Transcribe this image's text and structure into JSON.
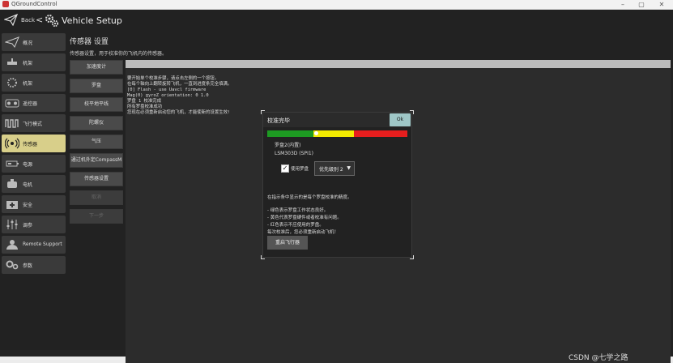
{
  "window": {
    "title": "QGroundControl"
  },
  "header": {
    "back_label": "Back",
    "back_arrow": "<",
    "title": "Vehicle Setup"
  },
  "sidebar": {
    "items": [
      {
        "label": "概况",
        "icon": "plane-outline-icon"
      },
      {
        "label": "机架",
        "icon": "frame-icon"
      },
      {
        "label": "机架",
        "icon": "dots-circle-icon"
      },
      {
        "label": "遥控器",
        "icon": "radio-icon"
      },
      {
        "label": "飞行模式",
        "icon": "wave-icon"
      },
      {
        "label": "传感器",
        "icon": "sensor-icon",
        "active": true
      },
      {
        "label": "电源",
        "icon": "battery-icon"
      },
      {
        "label": "电机",
        "icon": "motor-icon"
      },
      {
        "label": "安全",
        "icon": "safety-icon"
      },
      {
        "label": "调参",
        "icon": "sliders-icon"
      },
      {
        "label": "Remote Support",
        "icon": "remote-support-icon"
      },
      {
        "label": "参数",
        "icon": "params-gear-icon"
      }
    ]
  },
  "content": {
    "title": "传感器 设置",
    "description": "传感器设置，用于校准你的飞机内的传感器。"
  },
  "subnav": {
    "buttons": [
      {
        "label": "加速度计",
        "enabled": true
      },
      {
        "label": "罗盘",
        "enabled": true
      },
      {
        "label": "校平地平线",
        "enabled": true
      },
      {
        "label": "陀螺仪",
        "enabled": true
      },
      {
        "label": "气压",
        "enabled": true
      },
      {
        "label": "通过机外定CompassM",
        "enabled": true
      },
      {
        "label": "传感器设置",
        "enabled": true
      },
      {
        "label": "取消",
        "enabled": false
      },
      {
        "label": "下一步",
        "enabled": false
      }
    ]
  },
  "progress": {
    "fraction": 1.0
  },
  "log": {
    "lines": [
      "要开始单个校准步骤，请点击左侧的一个按钮。",
      "在每个轴向上翻转旋转飞机，一直到进度条完全填满。",
      "[0] Flash - use Uavcl firmware",
      "Mag(0) gyroZ orientation: 0 1.0",
      "罗盘 1 校准完成",
      "所有罗盘校准成功",
      "您现在必须重新启动您的飞机，才能使新的设置生效!"
    ]
  },
  "dialog": {
    "title": "校准完毕",
    "ok_label": "Ok",
    "severity": {
      "green_fraction": 0.33,
      "yellow_fraction": 0.29,
      "red_fraction": 0.38,
      "marker_fraction": 0.25
    },
    "colors": {
      "green": "#1d9a22",
      "yellow": "#f2ea00",
      "red": "#e61e1e"
    },
    "compass_name": "罗盘2(内置)",
    "sensor_name": "LSM303D (SPI1)",
    "use_compass_label": "使用罗盘",
    "use_compass_checked": true,
    "priority": {
      "selected": "优先级别 2"
    },
    "help_lines": [
      "在指示条中显示的是每个罗盘校准的精度。",
      "- 绿色表示罗盘工作状态良好。",
      "- 黄色代表罗盘硬件或者校准有问题。",
      "- 红色表示不应使用的罗盘。",
      "每次校准后，您必须重新启动飞机！"
    ],
    "reboot_label": "重启飞行器"
  },
  "watermark": {
    "text": "CSDN @七学之路"
  }
}
